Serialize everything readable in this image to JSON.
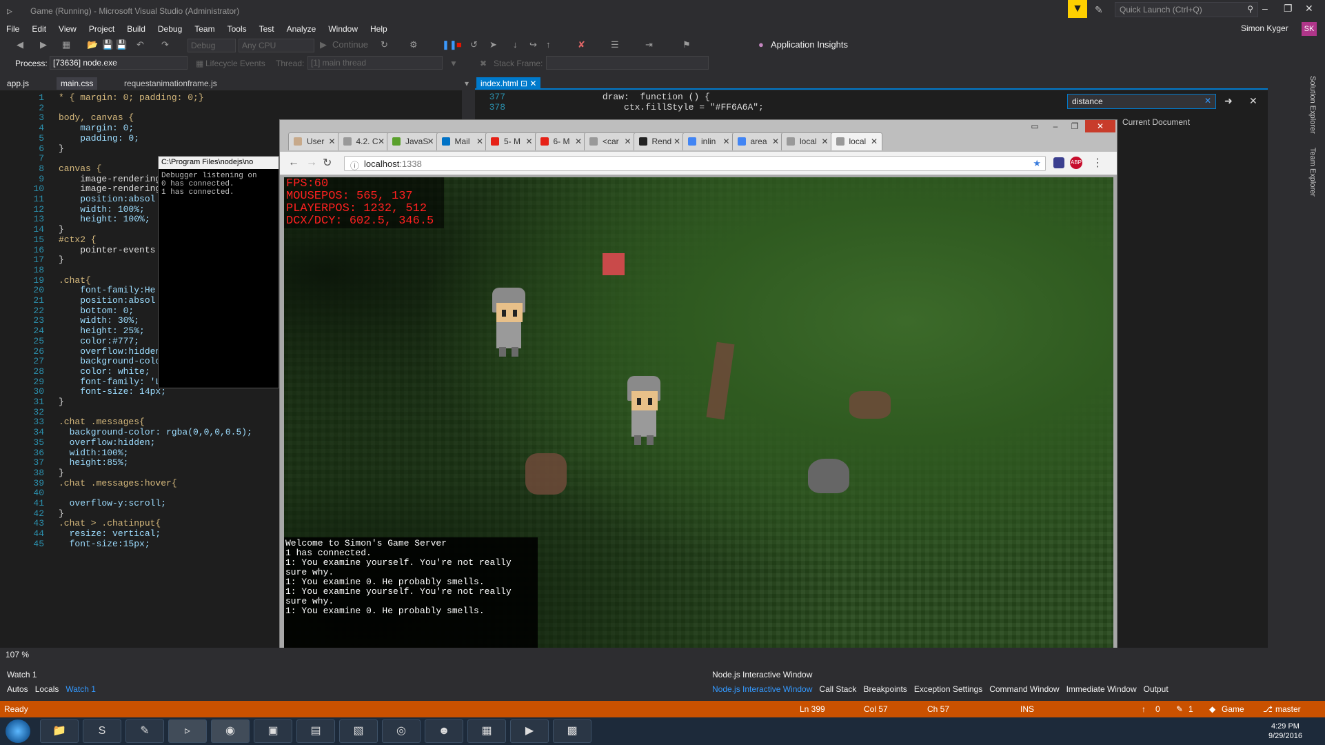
{
  "window": {
    "title": "Game (Running) - Microsoft Visual Studio (Administrator)",
    "quick_launch": "Quick Launch (Ctrl+Q)",
    "user_name": "Simon Kyger",
    "avatar_initials": "SK"
  },
  "menu": [
    "File",
    "Edit",
    "View",
    "Project",
    "Build",
    "Debug",
    "Team",
    "Tools",
    "Test",
    "Analyze",
    "Window",
    "Help"
  ],
  "toolbar": {
    "config": "Debug",
    "platform": "Any CPU",
    "continue_label": "Continue",
    "insights_label": "Application Insights",
    "process_label": "Process:",
    "process_value": "[73636] node.exe",
    "lifecycle_label": "Lifecycle Events",
    "thread_label": "Thread:",
    "thread_value": "[1] main thread",
    "stackframe_label": "Stack Frame:"
  },
  "left_tabs": [
    "app.js",
    "main.css",
    "requestanimationframe.js"
  ],
  "right_tab": "index.html",
  "left_code": [
    {
      "n": "1",
      "t": "* { margin: 0; padding: 0;}"
    },
    {
      "n": "2",
      "t": ""
    },
    {
      "n": "3",
      "t": "body, canvas {"
    },
    {
      "n": "4",
      "t": "    margin: 0;"
    },
    {
      "n": "5",
      "t": "    padding: 0;"
    },
    {
      "n": "6",
      "t": "}"
    },
    {
      "n": "7",
      "t": ""
    },
    {
      "n": "8",
      "t": "canvas {"
    },
    {
      "n": "9",
      "t": "    image-rendering"
    },
    {
      "n": "10",
      "t": "    image-rendering"
    },
    {
      "n": "11",
      "t": "    position:absol"
    },
    {
      "n": "12",
      "t": "    width: 100%;"
    },
    {
      "n": "13",
      "t": "    height: 100%;"
    },
    {
      "n": "14",
      "t": "}"
    },
    {
      "n": "15",
      "t": "#ctx2 {"
    },
    {
      "n": "16",
      "t": "    pointer-events"
    },
    {
      "n": "17",
      "t": "}"
    },
    {
      "n": "18",
      "t": ""
    },
    {
      "n": "19",
      "t": ".chat{"
    },
    {
      "n": "20",
      "t": "    font-family:He"
    },
    {
      "n": "21",
      "t": "    position:absol"
    },
    {
      "n": "22",
      "t": "    bottom: 0;"
    },
    {
      "n": "23",
      "t": "    width: 30%;"
    },
    {
      "n": "24",
      "t": "    height: 25%;"
    },
    {
      "n": "25",
      "t": "    color:#777;"
    },
    {
      "n": "26",
      "t": "    overflow:hidden;"
    },
    {
      "n": "27",
      "t": "    background-color: rgba(0,0,0,0.5);"
    },
    {
      "n": "28",
      "t": "    color: white;"
    },
    {
      "n": "29",
      "t": "    font-family: 'Lucida Console';"
    },
    {
      "n": "30",
      "t": "    font-size: 14px;"
    },
    {
      "n": "31",
      "t": "}"
    },
    {
      "n": "32",
      "t": ""
    },
    {
      "n": "33",
      "t": ".chat .messages{"
    },
    {
      "n": "34",
      "t": "  background-color: rgba(0,0,0,0.5);"
    },
    {
      "n": "35",
      "t": "  overflow:hidden;"
    },
    {
      "n": "36",
      "t": "  width:100%;"
    },
    {
      "n": "37",
      "t": "  height:85%;"
    },
    {
      "n": "38",
      "t": "}"
    },
    {
      "n": "39",
      "t": ".chat .messages:hover{"
    },
    {
      "n": "40",
      "t": ""
    },
    {
      "n": "41",
      "t": "  overflow-y:scroll;"
    },
    {
      "n": "42",
      "t": "}"
    },
    {
      "n": "43",
      "t": ".chat > .chatinput{"
    },
    {
      "n": "44",
      "t": "  resize: vertical;"
    },
    {
      "n": "45",
      "t": "  font-size:15px;"
    }
  ],
  "right_code": [
    {
      "n": "377",
      "t": "                draw:  function () {"
    },
    {
      "n": "378",
      "t": "                    ctx.fillStyle = \"#FF6A6A\";"
    }
  ],
  "find": {
    "value": "distance",
    "scope": "Current Document"
  },
  "side_tabs": [
    "Solution Explorer",
    "Team Explorer"
  ],
  "console": {
    "title": "C:\\Program Files\\nodejs\\no",
    "lines": [
      "Debugger listening on",
      "0 has connected.",
      "1 has connected."
    ]
  },
  "browser": {
    "tabs": [
      "User",
      "4.2. C",
      "JavaS",
      "Mail",
      "5- M",
      "6- M",
      "<car",
      "Rend",
      "inlin",
      "area",
      "local",
      "local"
    ],
    "tab_colors": [
      "#c7a98a",
      "#999999",
      "#5aa02c",
      "#0072c6",
      "#e62117",
      "#e62117",
      "#999999",
      "#222222",
      "#4285f4",
      "#4285f4",
      "#999999",
      "#999999"
    ],
    "url_host": "localhost",
    "url_port": ":1338"
  },
  "game": {
    "hud": [
      "FPS:60",
      "MOUSEPOS: 565, 137",
      "PLAYERPOS: 1232, 512",
      "DCX/DCY: 602.5, 346.5"
    ],
    "hud_color": "#ff2020",
    "marker_color": "#c94a4a",
    "chat": [
      "Welcome to Simon's Game Server",
      "1 has connected.",
      "1: You examine yourself. You're not really",
      "sure why.",
      "1: You examine 0. He probably smells.",
      "1: You examine yourself. You're not really",
      "sure why.",
      "1: You examine 0. He probably smells."
    ]
  },
  "bottom": {
    "zoom": "107 %",
    "watch_title": "Watch 1",
    "watch_tabs": [
      "Autos",
      "Locals",
      "Watch 1"
    ],
    "node_title": "Node.js Interactive Window",
    "node_tabs": [
      "Node.js Interactive Window",
      "Call Stack",
      "Breakpoints",
      "Exception Settings",
      "Command Window",
      "Immediate Window",
      "Output"
    ]
  },
  "status": {
    "ready": "Ready",
    "ln": "Ln 399",
    "col": "Col 57",
    "ch": "Ch 57",
    "ins": "INS",
    "up": "0",
    "pencil": "1",
    "repo": "Game",
    "branch": "master"
  },
  "taskbar": {
    "time": "4:29 PM",
    "date": "9/29/2016"
  },
  "colors": {
    "accent": "#007acc",
    "status": "#ca5100",
    "filter": "#fecf00"
  }
}
